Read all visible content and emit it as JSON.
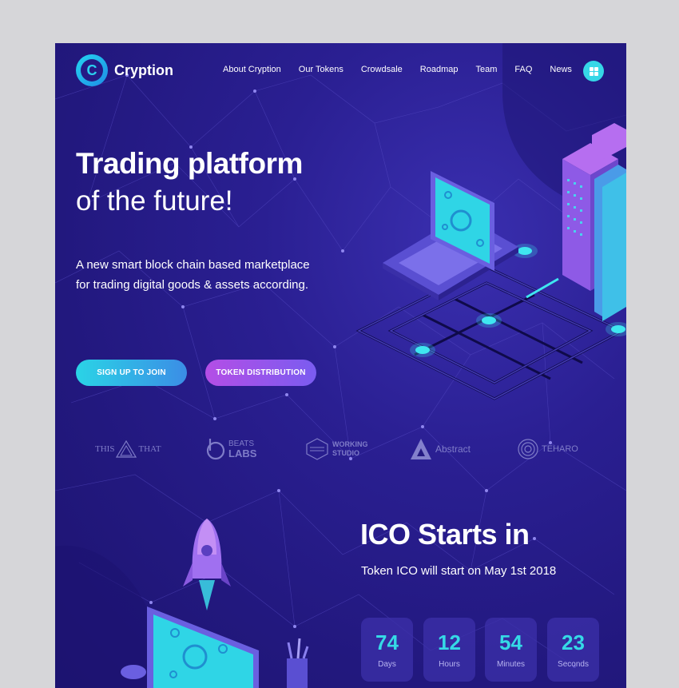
{
  "brand": {
    "name": "Cryption",
    "logo_icon": "c-coin-icon",
    "accent": "#36d7e7"
  },
  "nav": {
    "items": [
      {
        "label": "About Cryption"
      },
      {
        "label": "Our Tokens"
      },
      {
        "label": "Crowdsale"
      },
      {
        "label": "Roadmap"
      },
      {
        "label": "Team"
      },
      {
        "label": "FAQ"
      },
      {
        "label": "News"
      }
    ],
    "menu_icon": "grid-menu-icon"
  },
  "hero": {
    "title": "Trading platform",
    "subtitle": "of the future!",
    "description": "A new smart block chain based marketplace for trading digital goods & assets according."
  },
  "buttons": {
    "signup": "SIGN UP TO JOIN",
    "token": "TOKEN DISTRIBUTION"
  },
  "partners": {
    "this_that": {
      "left": "THIS",
      "right": "THAT"
    },
    "beats": {
      "top": "BEATS",
      "bottom": "LABS"
    },
    "working": {
      "top": "WORKING",
      "bottom": "STUDIO"
    },
    "abstract": {
      "name": "Abstract"
    },
    "teharo": {
      "name": "TEHARO"
    }
  },
  "ico": {
    "title": "ICO Starts in",
    "subtitle": "Token ICO will start on May 1st 2018",
    "countdown": [
      {
        "value": "74",
        "label": "Days"
      },
      {
        "value": "12",
        "label": "Hours"
      },
      {
        "value": "54",
        "label": "Minutes"
      },
      {
        "value": "23",
        "label": "Seconds"
      }
    ]
  }
}
